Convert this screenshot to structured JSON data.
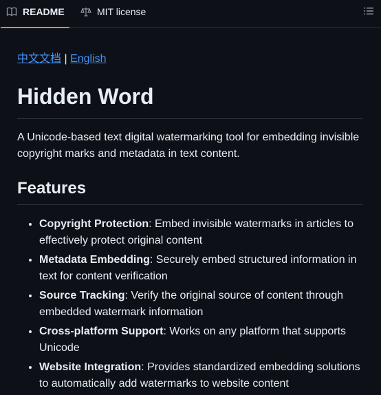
{
  "tabs": {
    "readme_label": "README",
    "license_label": "MIT license"
  },
  "links": {
    "chinese_docs": "中文文档",
    "separator": "|",
    "english": "English"
  },
  "title": "Hidden Word",
  "description": "A Unicode-based text digital watermarking tool for embedding invisible copyright marks and metadata in text content.",
  "features_heading": "Features",
  "features": [
    {
      "name": "Copyright Protection",
      "text": ": Embed invisible watermarks in articles to effectively protect original content"
    },
    {
      "name": "Metadata Embedding",
      "text": ": Securely embed structured information in text for content verification"
    },
    {
      "name": "Source Tracking",
      "text": ": Verify the original source of content through embedded watermark information"
    },
    {
      "name": "Cross-platform Support",
      "text": ": Works on any platform that supports Unicode"
    },
    {
      "name": "Website Integration",
      "text": ": Provides standardized embedding solutions to automatically add watermarks to website content"
    }
  ],
  "colors": {
    "background": "#0d1117",
    "text": "#e6edf3",
    "link": "#4493f8",
    "active_tab_underline": "#f78166",
    "divider": "#30363d"
  }
}
